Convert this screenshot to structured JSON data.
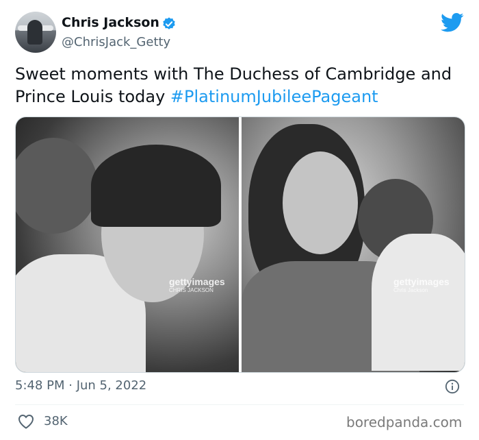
{
  "author": {
    "name": "Chris Jackson",
    "handle": "@ChrisJack_Getty",
    "verified": true,
    "verified_color": "#1d9bf0"
  },
  "platform_icon": "twitter-bird-icon",
  "tweet": {
    "text": "Sweet moments with The Duchess of Cambridge and Prince Louis today ",
    "hashtag": "#PlatinumJubileePageant",
    "hashtag_color": "#1d9bf0"
  },
  "media": {
    "photos": [
      {
        "watermark": "gettyimages",
        "credit": "CHRIS JACKSON"
      },
      {
        "watermark": "gettyimages",
        "credit": "Chris Jackson"
      }
    ]
  },
  "meta": {
    "timestamp": "5:48 PM · Jun 5, 2022",
    "likes": "38K"
  },
  "source_site": "boredpanda.com"
}
